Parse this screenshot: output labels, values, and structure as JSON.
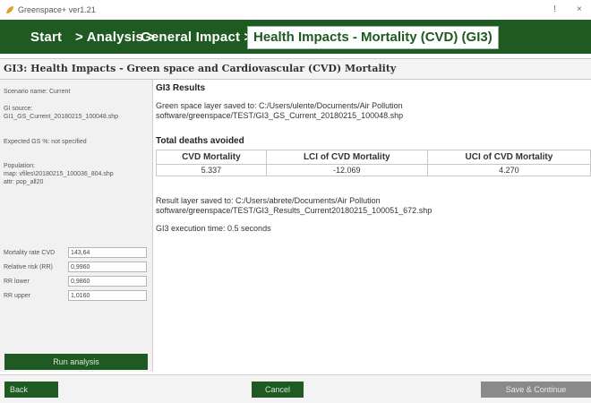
{
  "window": {
    "title": "Greenspace+ ver1.21",
    "menu_glyph": "!",
    "close_glyph": "×"
  },
  "nav": {
    "start": "Start",
    "analysis": "> Analysis >",
    "general_impact": "General Impact >",
    "active": "Health Impacts - Mortality (CVD) (GI3)"
  },
  "page_title": "GI3: Health Impacts - Green space and Cardiovascular (CVD) Mortality",
  "left_panel": {
    "scenario": "Scenario name: Current",
    "gi_source_label": "GI source:",
    "gi_source_value": "GI1_GS_Current_20180215_100048.shp",
    "expected_gs": "Expected GS %: not specified",
    "population_label": "Population:",
    "population_map": "map: vfiles\\20180215_100036_804.shp",
    "population_attr": "attr: pop_all20",
    "params": [
      {
        "label": "Mortality rate CVD",
        "value": "143,64"
      },
      {
        "label": "Relative risk (RR)",
        "value": "0,9960"
      },
      {
        "label": "RR lower",
        "value": "0,9860"
      },
      {
        "label": "RR upper",
        "value": "1,0160"
      }
    ],
    "run_button": "Run analysis"
  },
  "content": {
    "results_title": "GI3 Results",
    "gs_saved_line1": "Green space layer saved to: C:/Users/ulente/Documents/Air Pollution",
    "gs_saved_line2": "software/greenspace/TEST/GI3_GS_Current_20180215_100048.shp",
    "deaths_title": "Total deaths avoided",
    "table": {
      "headers": [
        "CVD Mortality",
        "LCI of CVD Mortality",
        "UCI of CVD Mortality"
      ],
      "row": [
        "5.337",
        "-12.069",
        "4.270"
      ]
    },
    "result_saved_line1": "Result layer saved to: C:/Users/abrete/Documents/Air Pollution",
    "result_saved_line2": "software/greenspace/TEST/GI3_Results_Current20180215_100051_672.shp",
    "exec_time": "GI3 execution time: 0.5 seconds"
  },
  "footer": {
    "back": "Back",
    "cancel": "Cancel",
    "save": "Save & Continue"
  },
  "colors": {
    "nav_green": "#1e5a22",
    "disabled_gray": "#8a8a8a"
  }
}
